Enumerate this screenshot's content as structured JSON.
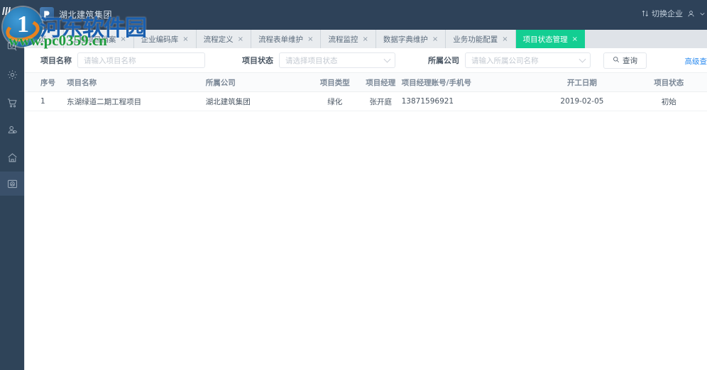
{
  "header": {
    "brand": "湖北建筑集团",
    "switch_enterprise": "切换企业",
    "switch_icon": "switch-icon",
    "user_icon": "user-icon"
  },
  "sidebar": {
    "items": [
      {
        "icon": "image-search-icon",
        "name": "sidebar-item-image-search"
      },
      {
        "icon": "gear-icon",
        "name": "sidebar-item-settings"
      },
      {
        "icon": "cart-icon",
        "name": "sidebar-item-cart"
      },
      {
        "icon": "user-icon",
        "name": "sidebar-item-user"
      },
      {
        "icon": "home-icon",
        "name": "sidebar-item-home"
      },
      {
        "icon": "photo-icon",
        "name": "sidebar-item-photo"
      }
    ]
  },
  "tabs": [
    {
      "label": "首页",
      "close": "×",
      "active": false
    },
    {
      "label": "工程项目档案",
      "close": "×",
      "active": false
    },
    {
      "label": "企业编码库",
      "close": "×",
      "active": false
    },
    {
      "label": "流程定义",
      "close": "×",
      "active": false
    },
    {
      "label": "流程表单维护",
      "close": "×",
      "active": false
    },
    {
      "label": "流程监控",
      "close": "×",
      "active": false
    },
    {
      "label": "数据字典维护",
      "close": "×",
      "active": false
    },
    {
      "label": "业务功能配置",
      "close": "×",
      "active": false
    },
    {
      "label": "项目状态管理",
      "close": "×",
      "active": true
    }
  ],
  "filters": {
    "project_name": {
      "label": "项目名称",
      "placeholder": "请输入项目名称",
      "value": ""
    },
    "project_status": {
      "label": "项目状态",
      "placeholder": "请选择项目状态",
      "value": ""
    },
    "company": {
      "label": "所属公司",
      "placeholder": "请输入所属公司名称",
      "value": ""
    },
    "search_button": "查询",
    "advanced_link": "高级查"
  },
  "table": {
    "columns": [
      "序号",
      "项目名称",
      "所属公司",
      "项目类型",
      "项目经理",
      "项目经理账号/手机号",
      "开工日期",
      "项目状态"
    ],
    "rows": [
      {
        "index": "1",
        "name": "东湖绿道二期工程项目",
        "company": "湖北建筑集团",
        "type": "绿化",
        "manager": "张开庭",
        "account": "13871596921",
        "start_date": "2019-02-05",
        "status": "初始"
      }
    ]
  },
  "watermark": {
    "site_name": "河东软件园",
    "url": "www.pc0359.cn",
    "logo_digit": "1"
  },
  "colors": {
    "header_bg": "#2e4259",
    "sidebar_bg": "#2f4459",
    "active_tab": "#13ce92",
    "link": "#2d8cf0"
  }
}
